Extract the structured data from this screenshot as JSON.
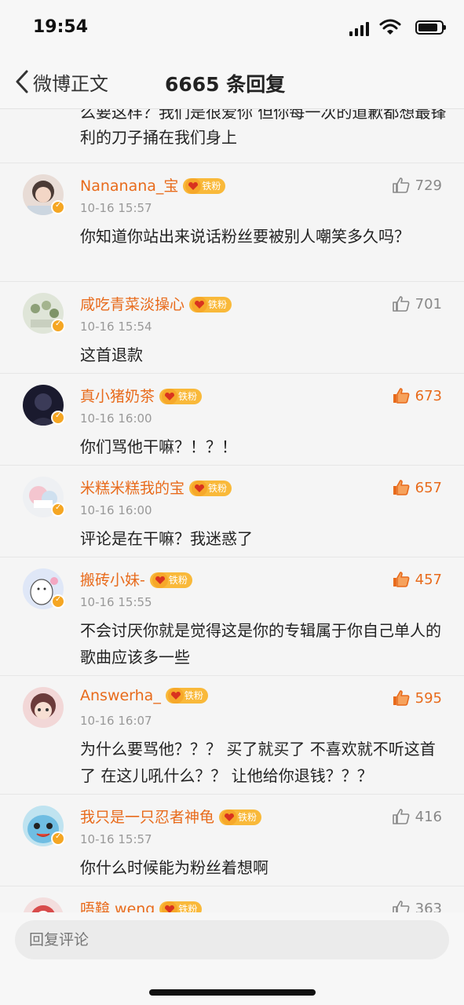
{
  "status_bar": {
    "time": "19:54"
  },
  "nav": {
    "back_label": "微博正文",
    "title": "6665 条回复"
  },
  "partial_comment": {
    "text": "么要这样？我们是很爱你 但你每一次的道歉都想最锋利的刀子捅在我们身上"
  },
  "badge_label": "铁粉",
  "colors": {
    "accent": "#e86b1c",
    "badge": "#f9b93a",
    "verify": "#f5a623"
  },
  "comments": [
    {
      "username": "Nananana_宝",
      "time": "10-16 15:57",
      "likes": "729",
      "liked": false,
      "text": "你知道你站出来说话粉丝要被别人嘲笑多久吗？"
    },
    {
      "username": "咸吃青菜淡操心",
      "time": "10-16 15:54",
      "likes": "701",
      "liked": false,
      "text": "这首退款"
    },
    {
      "username": "真小猪奶茶",
      "time": "10-16 16:00",
      "likes": "673",
      "liked": true,
      "text": "你们骂他干嘛？！？！"
    },
    {
      "username": "米糕米糕我的宝",
      "time": "10-16 16:00",
      "likes": "657",
      "liked": true,
      "text": "评论是在干嘛？我迷惑了"
    },
    {
      "username": "搬砖小妹-",
      "time": "10-16 15:55",
      "likes": "457",
      "liked": true,
      "text": "不会讨厌你就是觉得这是你的专辑属于你自己单人的歌曲应该多一些"
    },
    {
      "username": "Answerha_",
      "time": "10-16 16:07",
      "likes": "595",
      "liked": true,
      "text": "为什么要骂他？？？ 买了就买了 不喜欢就不听这首了 在这儿吼什么？？ 让他给你退钱？？？"
    },
    {
      "username": "我只是一只忍者神龟",
      "time": "10-16 15:57",
      "likes": "416",
      "liked": false,
      "text": "你什么时候能为粉丝着想啊"
    },
    {
      "username": "唔鞥 weng",
      "time": "",
      "likes": "363",
      "liked": false,
      "text": ""
    }
  ],
  "reply": {
    "placeholder": "回复评论"
  }
}
